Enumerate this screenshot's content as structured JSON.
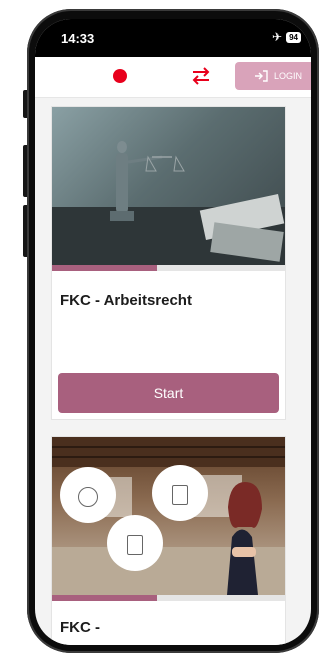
{
  "status_bar": {
    "time": "14:33",
    "battery": "94",
    "airplane_icon": "airplane-icon"
  },
  "app_bar": {
    "login_label": "LOGIN",
    "record_icon": "record-dot-icon",
    "swap_icon": "swap-arrows-icon",
    "login_icon": "login-icon"
  },
  "courses": [
    {
      "title": "FKC - Arbeitsrecht",
      "start_label": "Start",
      "progress": 0.45
    },
    {
      "title": "FKC -",
      "progress": 0.45
    }
  ],
  "colors": {
    "accent": "#a8607e",
    "login_bg": "#d9a3ba",
    "record": "#e8001c",
    "swap": "#e8001c"
  }
}
